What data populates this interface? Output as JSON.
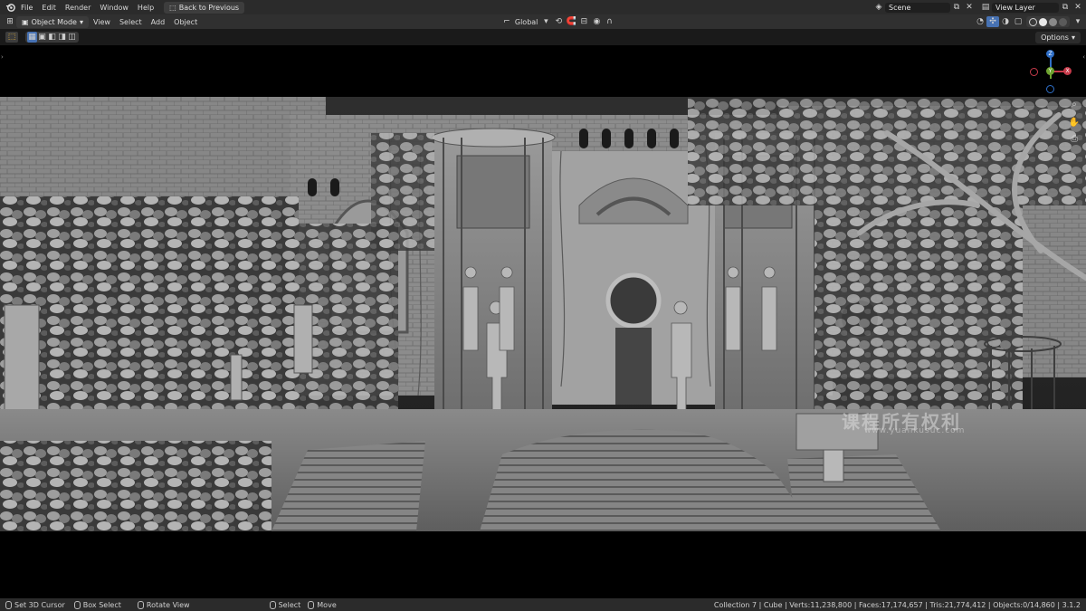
{
  "topbar": {
    "menus": [
      "File",
      "Edit",
      "Render",
      "Window",
      "Help"
    ],
    "back_button": "Back to Previous",
    "scene_label": "Scene",
    "view_layer_label": "View Layer"
  },
  "header": {
    "mode": "Object Mode",
    "menus": [
      "View",
      "Select",
      "Add",
      "Object"
    ],
    "transform_orientation": "Global"
  },
  "toolrow": {
    "options_label": "Options"
  },
  "gizmo": {
    "z": "Z",
    "y": "Y",
    "x": "X"
  },
  "watermark": {
    "main": "课程所有权利",
    "sub": "www.yuankusuc.com"
  },
  "statusbar": {
    "hints": [
      {
        "icon": "mouse-left-icon",
        "label": "Set 3D Cursor"
      },
      {
        "icon": "mouse-left-icon",
        "label": "Box Select"
      },
      {
        "icon": "mouse-middle-icon",
        "label": "Rotate View"
      },
      {
        "icon": "mouse-left-icon",
        "label": "Select"
      },
      {
        "icon": "mouse-left-icon",
        "label": "Move"
      }
    ],
    "stats": "Collection 7 | Cube | Verts:11,238,800 | Faces:17,174,657 | Tris:21,774,412 | Objects:0/14,860 | 3.1.2"
  },
  "colors": {
    "accent": "#4772b3",
    "gizmo_x": "#c63a4a",
    "gizmo_y": "#6fa430",
    "gizmo_z": "#2f6fc8"
  }
}
